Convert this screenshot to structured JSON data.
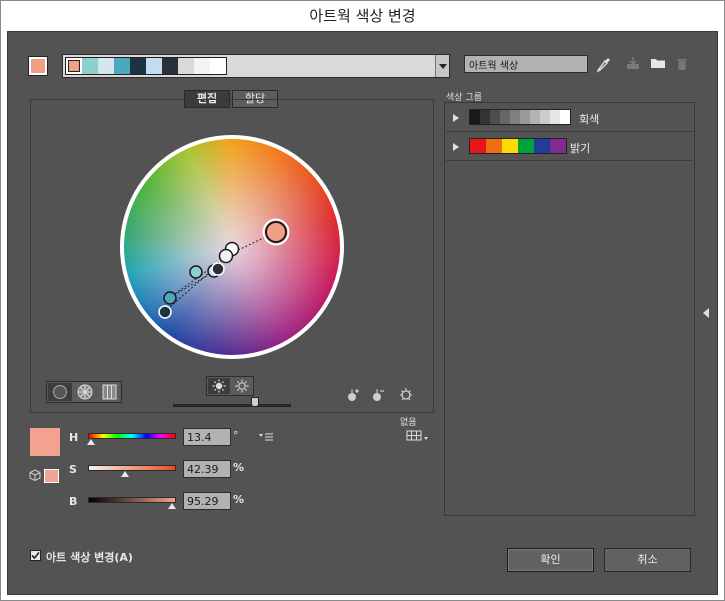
{
  "window": {
    "title": "아트웍 색상 변경"
  },
  "top": {
    "swatch_strip": [
      "#f2a085",
      "#8ed0d0",
      "#d6e6ee",
      "#4da8bf",
      "#1e3340",
      "#c2dcf2",
      "#2a3038",
      "#d9d9d9",
      "#f4f4f4",
      "#ffffff"
    ],
    "group_name_value": "아트웍 색상",
    "current_color": "#f2a085"
  },
  "tabs": {
    "edit": "편집",
    "assign": "할당"
  },
  "color_groups": {
    "header": "색상 그룹",
    "items": [
      {
        "name": "회색",
        "swatches": [
          "#1a1a1a",
          "#333333",
          "#4d4d4d",
          "#666666",
          "#808080",
          "#999999",
          "#b3b3b3",
          "#cccccc",
          "#e6e6e6",
          "#ffffff"
        ]
      },
      {
        "name": "밝기",
        "swatches": [
          "#e8161b",
          "#ee6f12",
          "#fbdc00",
          "#00a33b",
          "#1f3d99",
          "#7f2b8f"
        ]
      }
    ]
  },
  "hsb": {
    "h_label": "H",
    "h_value": "13.4",
    "h_unit": "°",
    "s_label": "S",
    "s_value": "42.39",
    "s_unit": "%",
    "b_label": "B",
    "b_value": "95.29",
    "b_unit": "%",
    "h_level": 0.037,
    "s_level": 0.424,
    "b_level": 0.953,
    "selected_color": "#f2a28f",
    "gamut_color": "#f4a39a"
  },
  "none_label": "없음",
  "footer": {
    "recolor_checkbox": "아트 색상 변경(A)",
    "recolor_checked": true,
    "ok": "확인",
    "cancel": "취소"
  }
}
